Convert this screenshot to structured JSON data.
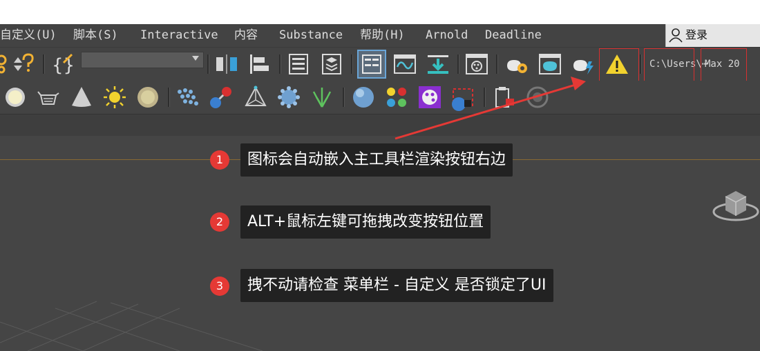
{
  "menu": {
    "items": [
      "自定义(U)",
      "脚本(S)",
      "Interactive",
      "内容",
      "Substance",
      "帮助(H)",
      "Arnold",
      "Deadline"
    ],
    "login_label": "登录"
  },
  "toolbar": {
    "path_field_1": "C:\\Users\\⋯",
    "path_field_2": "Max 20"
  },
  "callouts": [
    {
      "number": "1",
      "text": "图标会自动嵌入主工具栏渲染按钮右边"
    },
    {
      "number": "2",
      "text": "ALT+鼠标左键可拖拽改变按钮位置"
    },
    {
      "number": "3",
      "text": "拽不动请检查 菜单栏 - 自定义 是否锁定了UI"
    }
  ],
  "colors": {
    "ui_bg": "#434343",
    "callout_badge": "#e53935",
    "callout_bg": "#222222",
    "highlight_box": "#d83030",
    "warning_icon": "#f2d22e"
  },
  "icons": {
    "toolbar_row1": [
      "help-icon",
      "reference-coord-icon",
      "named-selection-icon",
      "selection-set-dropdown",
      "mirror-icon",
      "align-icon",
      "scene-explorer-icon",
      "layer-explorer-icon",
      "toggle-ribbon-icon",
      "curve-editor-icon",
      "schematic-view-icon",
      "material-editor-icon",
      "render-setup-icon",
      "rendered-frame-window-icon",
      "render-production-icon",
      "render-iterative-icon",
      "warning-icon"
    ],
    "toolbar_row2": [
      "sphere-light-icon",
      "teapot-icon",
      "cone-icon",
      "sun-icon",
      "sky-icon",
      "particle-icon",
      "molecule-icon",
      "bone-icon",
      "scatter-icon",
      "grass-icon",
      "material-sphere-icon",
      "color-balls-icon",
      "palette-icon",
      "render-region-icon",
      "blue-sphere-icon",
      "clipboard-icon",
      "disabled-icon"
    ]
  }
}
